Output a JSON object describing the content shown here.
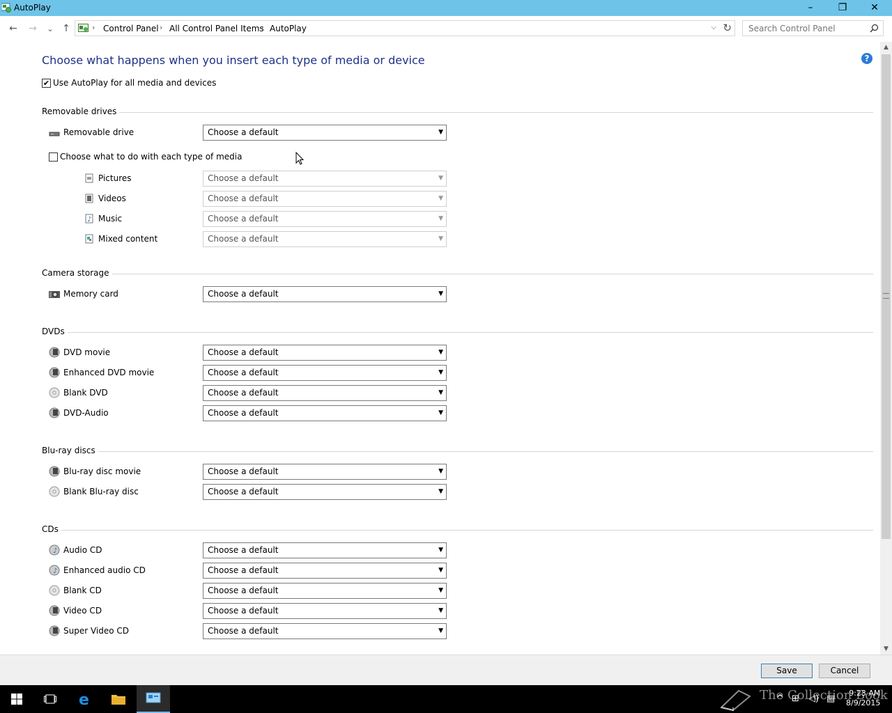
{
  "window": {
    "title": "AutoPlay",
    "minimize": "–",
    "maximize": "❐",
    "close": "✕"
  },
  "nav": {
    "back": "←",
    "forward": "→",
    "recent": "⌄",
    "up": "↑",
    "breadcrumbs": [
      "Control Panel",
      "All Control Panel Items",
      "AutoPlay"
    ],
    "search_placeholder": "Search Control Panel"
  },
  "page": {
    "title": "Choose what happens when you insert each type of media or device",
    "help": "?",
    "master_checkbox_label": "Use AutoPlay for all media and devices",
    "master_checked": true,
    "select_default": "Choose a default"
  },
  "sections": {
    "removable": {
      "heading": "Removable drives",
      "removable_drive": "Removable drive",
      "media_checkbox_label": "Choose what to do with each type of media",
      "media_checked": false,
      "pictures": "Pictures",
      "videos": "Videos",
      "music": "Music",
      "mixed": "Mixed content"
    },
    "camera": {
      "heading": "Camera storage",
      "memory_card": "Memory card"
    },
    "dvds": {
      "heading": "DVDs",
      "dvd_movie": "DVD movie",
      "enhanced_dvd_movie": "Enhanced DVD movie",
      "blank_dvd": "Blank DVD",
      "dvd_audio": "DVD-Audio"
    },
    "bluray": {
      "heading": "Blu-ray discs",
      "movie": "Blu-ray disc movie",
      "blank": "Blank Blu-ray disc"
    },
    "cds": {
      "heading": "CDs",
      "audio_cd": "Audio CD",
      "enhanced_audio_cd": "Enhanced audio CD",
      "blank_cd": "Blank CD",
      "video_cd": "Video CD",
      "super_video_cd": "Super Video CD"
    }
  },
  "footer": {
    "save": "Save",
    "cancel": "Cancel"
  },
  "taskbar": {
    "time": "9:23 AM",
    "date": "8/9/2015",
    "watermark": "The Collection Book"
  },
  "colors": {
    "titlebar": "#6dc4e8",
    "page_title": "#1e3287",
    "help": "#2b7bd6",
    "taskbar": "#000000"
  }
}
